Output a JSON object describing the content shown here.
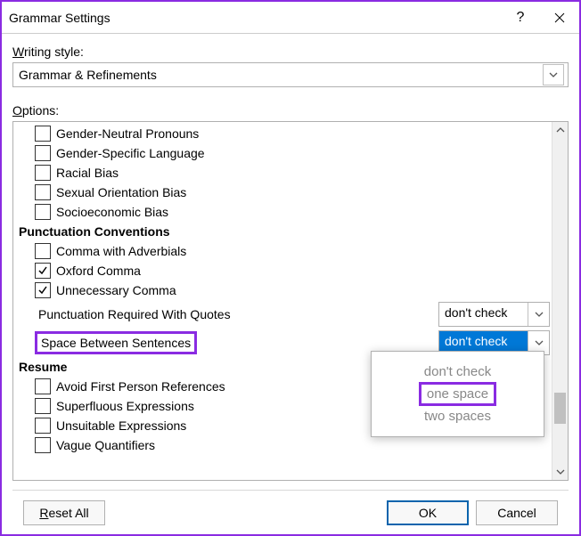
{
  "titlebar": {
    "title": "Grammar Settings"
  },
  "labels": {
    "writing_style": "Writing style:",
    "options": "Options:"
  },
  "writing_style_value": "Grammar & Refinements",
  "cats": {
    "punctuation": "Punctuation Conventions",
    "resume": "Resume"
  },
  "items": {
    "gender_neutral": "Gender-Neutral Pronouns",
    "gender_specific": "Gender-Specific Language",
    "racial_bias": "Racial Bias",
    "sexual_bias": "Sexual Orientation Bias",
    "socio_bias": "Socioeconomic Bias",
    "comma_adv": "Comma with Adverbials",
    "oxford": "Oxford Comma",
    "unnec_comma": "Unnecessary Comma",
    "punct_quotes": "Punctuation Required With Quotes",
    "space_sent": "Space Between Sentences",
    "avoid_first": "Avoid First Person References",
    "superfluous": "Superfluous Expressions",
    "unsuitable": "Unsuitable Expressions",
    "vague": "Vague Quantifiers"
  },
  "drops": {
    "punct_quotes_value": "don't check",
    "space_sent_value": "don't check"
  },
  "popup": {
    "o1": "don't check",
    "o2": "one space",
    "o3": "two spaces"
  },
  "buttons": {
    "reset": "Reset All",
    "ok": "OK",
    "cancel": "Cancel"
  }
}
